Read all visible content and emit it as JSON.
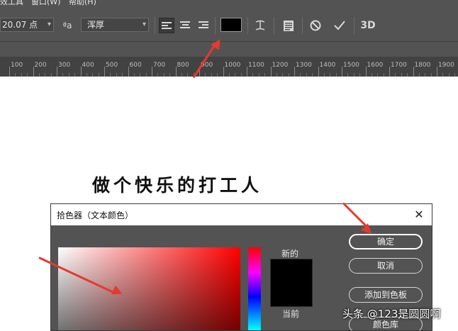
{
  "menubar": {
    "items": [
      "效工具",
      "窗口(W)",
      "帮助(H)"
    ]
  },
  "options_bar": {
    "font_size": "20.07 点",
    "aa_label": "ªa",
    "antialias": "浑厚",
    "color_swatch": "#000000",
    "icons": [
      "align-left-icon",
      "align-center-icon",
      "align-right-icon",
      "warp-text-icon",
      "panel-icon",
      "cancel-icon",
      "commit-icon"
    ],
    "label_3d": "3D"
  },
  "ruler": {
    "labels": [
      "100",
      "200",
      "300",
      "400",
      "500",
      "600",
      "700",
      "800",
      "900",
      "1000",
      "1100",
      "1200",
      "1300",
      "1400",
      "1500",
      "1600",
      "1700",
      "1800",
      "1900"
    ]
  },
  "canvas": {
    "headline": "做个快乐的打工人"
  },
  "dialog": {
    "title": "拾色器（文本颜色）",
    "close_glyph": "✕",
    "label_new": "新的",
    "label_current": "当前",
    "new_color": "#000000",
    "buttons": {
      "ok": "确定",
      "cancel": "取消",
      "add_swatch": "添加到色板",
      "color_library": "颜色库"
    }
  },
  "accent_color": "#e53a2f",
  "watermark": "头条 @123是圆圆啊"
}
